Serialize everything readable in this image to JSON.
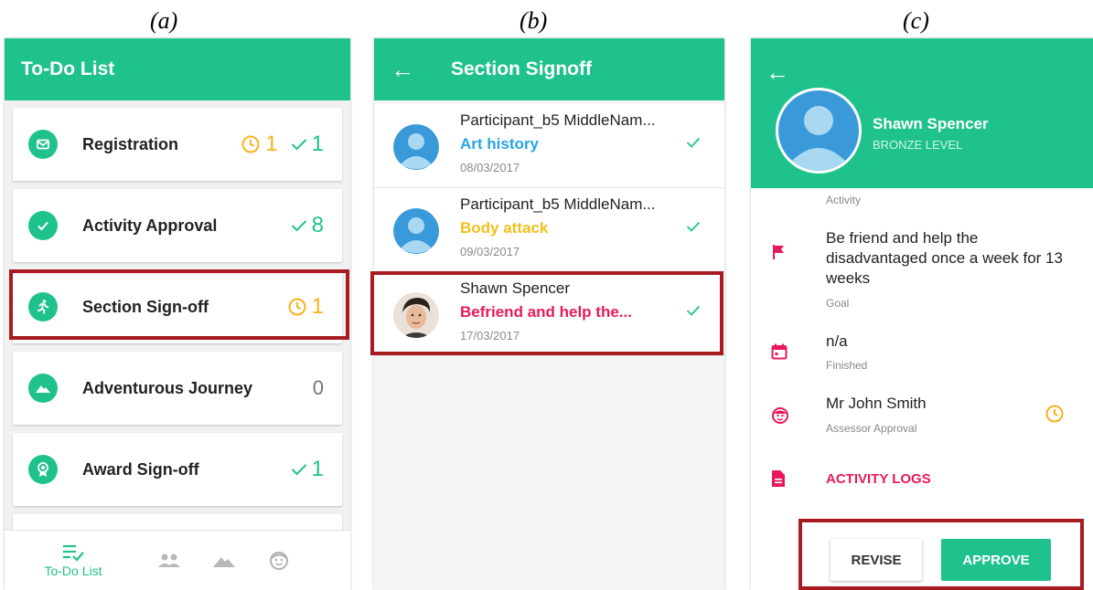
{
  "captions": {
    "a": "(a)",
    "b": "(b)",
    "c": "(c)"
  },
  "colors": {
    "brand": "#1fc28c",
    "pending": "#f7b21c",
    "highlight": "#a81b20",
    "accent_red": "#e8195a"
  },
  "panel_a": {
    "title": "To-Do List",
    "items": [
      {
        "label": "Registration",
        "icon": "mail-icon",
        "pending": "1",
        "done": "1"
      },
      {
        "label": "Activity Approval",
        "icon": "check-circle-icon",
        "done": "8"
      },
      {
        "label": "Section Sign-off",
        "icon": "running-person-icon",
        "pending": "1"
      },
      {
        "label": "Adventurous Journey",
        "icon": "mountain-icon",
        "count": "0"
      },
      {
        "label": "Award Sign-off",
        "icon": "award-icon",
        "done": "1"
      }
    ],
    "nav": {
      "todo_label": "To-Do List"
    }
  },
  "panel_b": {
    "title": "Section Signoff",
    "items": [
      {
        "name": "Participant_b5 MiddleNam...",
        "activity": "Art history",
        "activity_color": "#26a5e4",
        "date": "08/03/2017"
      },
      {
        "name": "Participant_b5 MiddleNam...",
        "activity": "Body attack",
        "activity_color": "#f2c01b",
        "date": "09/03/2017"
      },
      {
        "name": "Shawn Spencer",
        "activity": "Befriend and help the...",
        "activity_color": "#e8195a",
        "date": "17/03/2017"
      }
    ]
  },
  "panel_c": {
    "name": "Shawn Spencer",
    "level": "BRONZE LEVEL",
    "activity_label": "Activity",
    "goal_text": "Be friend and help the disadvantaged once a week for 13 weeks",
    "goal_label": "Goal",
    "finished_value": "n/a",
    "finished_label": "Finished",
    "assessor_name": "Mr John Smith",
    "assessor_label": "Assessor Approval",
    "logs_label": "ACTIVITY LOGS",
    "revise_label": "REVISE",
    "approve_label": "APPROVE"
  }
}
